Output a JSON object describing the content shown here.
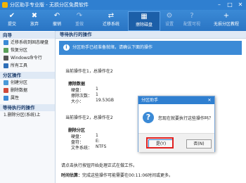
{
  "window": {
    "title": "分区助手专业版 - 无损分区免费软件",
    "minimize": "–",
    "maximize": "□",
    "close": "✕"
  },
  "toolbar": {
    "items": [
      {
        "icon": "✔",
        "label": "提交"
      },
      {
        "icon": "✖",
        "label": "放弃"
      },
      {
        "icon": "↶",
        "label": "撤销"
      },
      {
        "icon": "↷",
        "label": "重做"
      },
      {
        "icon": "⇄",
        "label": "迁移系统"
      },
      {
        "icon": "▦",
        "label": "擦除磁盘"
      },
      {
        "icon": "⚙",
        "label": "设置"
      },
      {
        "icon": "?",
        "label": "配置可视"
      },
      {
        "icon": "+",
        "label": "无损分区教程"
      }
    ]
  },
  "sidebar": {
    "sections": [
      {
        "title": "向导",
        "items": [
          "迁移系统到固态硬盘",
          "恢复分区",
          "Windows命令行",
          "所有工具"
        ]
      },
      {
        "title": "分区操作",
        "items": [
          "创建分区",
          "删除数据",
          "属性"
        ]
      },
      {
        "title": "等待执行的操作",
        "items": [
          "1.删除分区(系统)上"
        ]
      }
    ]
  },
  "main": {
    "header": "等待执行的操作",
    "banner": "分区助手已经准备就绪，请确认下面的操作",
    "op1_summary": "当前操作在1，总操作在2",
    "op1_title": "擦除数据",
    "op1_fields": [
      {
        "k": "硬盘：",
        "v": "1"
      },
      {
        "k": "擦除次数：",
        "v": "1"
      },
      {
        "k": "大小：",
        "v": "19.53GB"
      }
    ],
    "op2_summary": "当前操作在2，总操作在2",
    "op2_title": "删除分区",
    "op2_fields": [
      {
        "k": "硬盘：",
        "v": "1"
      },
      {
        "k": "盘符：",
        "v": "E:"
      },
      {
        "k": "文件系统：",
        "v": "NTFS"
      }
    ],
    "footer1": "请点击执行按钮开始处理正式在做工作。",
    "footer2_label": "时间估算：",
    "footer2_text": "完成这些操作可能需要在00:11:06时间或更多。"
  },
  "dialog": {
    "title": "分区助手",
    "message": "您现在就要执行这些操作吗？",
    "yes": "是(Y)",
    "no": "否(N)"
  }
}
